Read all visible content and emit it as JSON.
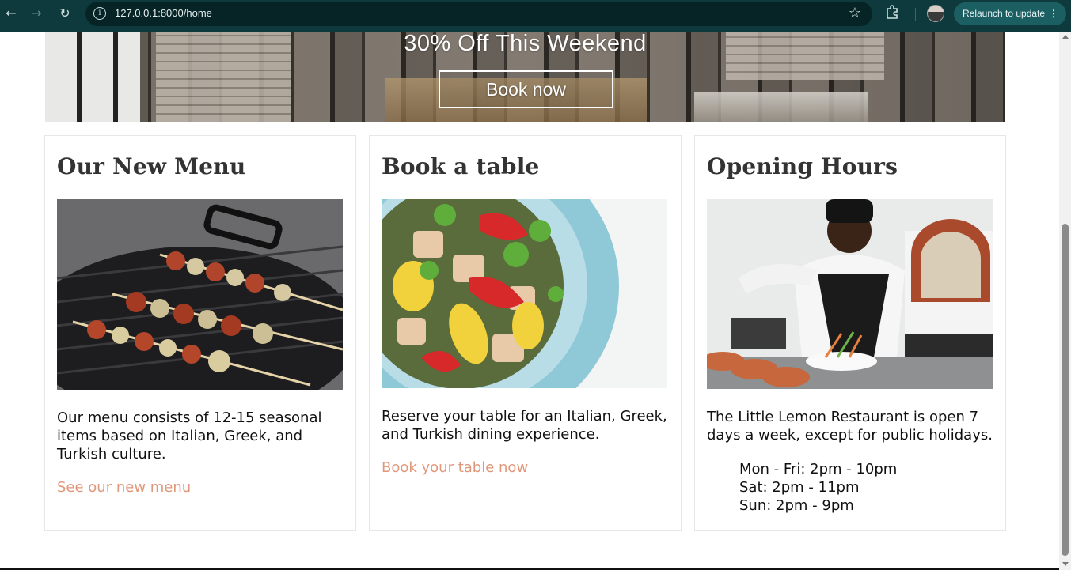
{
  "browser": {
    "url": "127.0.0.1:8000/home",
    "relaunch_label": "Relaunch to update"
  },
  "hero": {
    "title": "30% Off This Weekend",
    "button_label": "Book now"
  },
  "cards": [
    {
      "title": "Our New Menu",
      "image_icon": "grill-skewers-image",
      "text": "Our menu consists of 12-15 seasonal items based on Italian, Greek, and Turkish culture.",
      "link": "See our new menu"
    },
    {
      "title": "Book a table",
      "image_icon": "salad-plate-image",
      "text": "Reserve your table for an Italian, Greek, and Turkish dining experience.",
      "link": "Book your table now"
    },
    {
      "title": "Opening Hours",
      "image_icon": "chef-cooking-image",
      "text": "The Little Lemon Restaurant is open 7 days a week, except for public holidays.",
      "hours": [
        "Mon - Fri: 2pm - 10pm",
        "Sat: 2pm - 11pm",
        "Sun: 2pm - 9pm"
      ]
    }
  ],
  "colors": {
    "link": "#e0977a",
    "chrome": "#0f3a3d",
    "heading": "#333333"
  }
}
